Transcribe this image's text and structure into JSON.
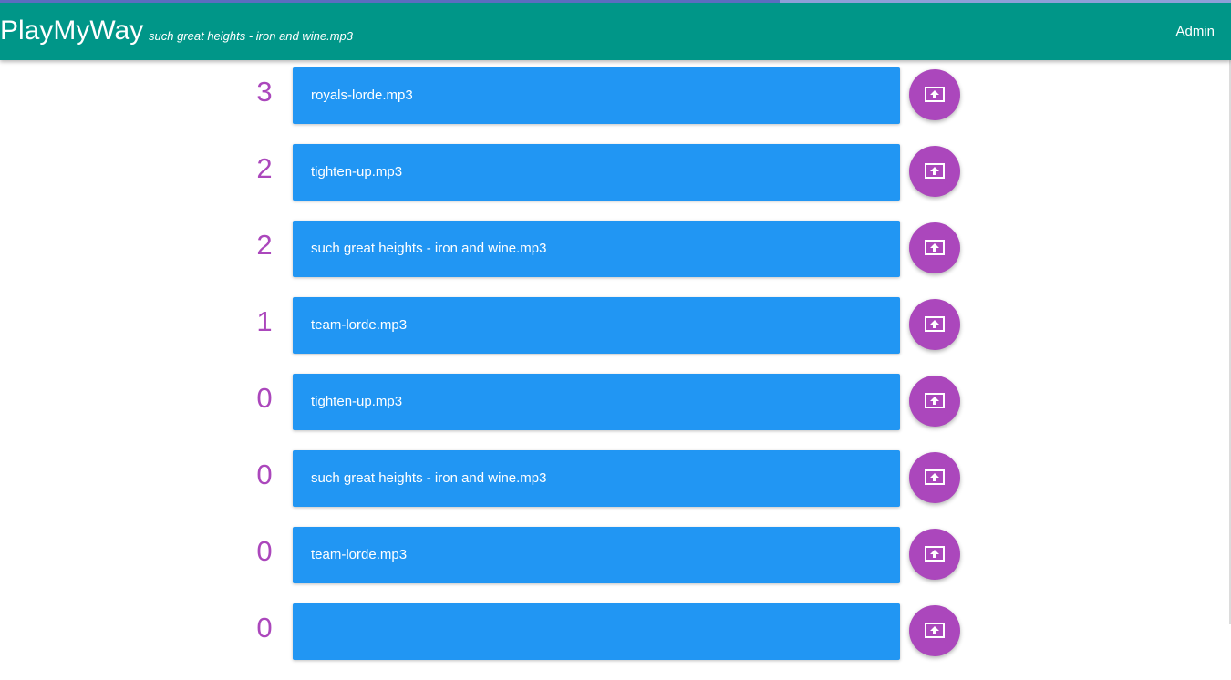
{
  "app": {
    "title": "PlayMyWay",
    "now_playing": "such great heights - iron and wine.mp3",
    "admin_label": "Admin"
  },
  "colors": {
    "topbar": "#009688",
    "song_card": "#2196f3",
    "accent": "#ab47bc"
  },
  "icons": {
    "upvote": "upvote-icon"
  },
  "queue": [
    {
      "votes": "3",
      "title": "royals-lorde.mp3"
    },
    {
      "votes": "2",
      "title": "tighten-up.mp3"
    },
    {
      "votes": "2",
      "title": "such great heights - iron and wine.mp3"
    },
    {
      "votes": "1",
      "title": "team-lorde.mp3"
    },
    {
      "votes": "0",
      "title": "tighten-up.mp3"
    },
    {
      "votes": "0",
      "title": "such great heights - iron and wine.mp3"
    },
    {
      "votes": "0",
      "title": "team-lorde.mp3"
    },
    {
      "votes": "0",
      "title": ""
    }
  ]
}
